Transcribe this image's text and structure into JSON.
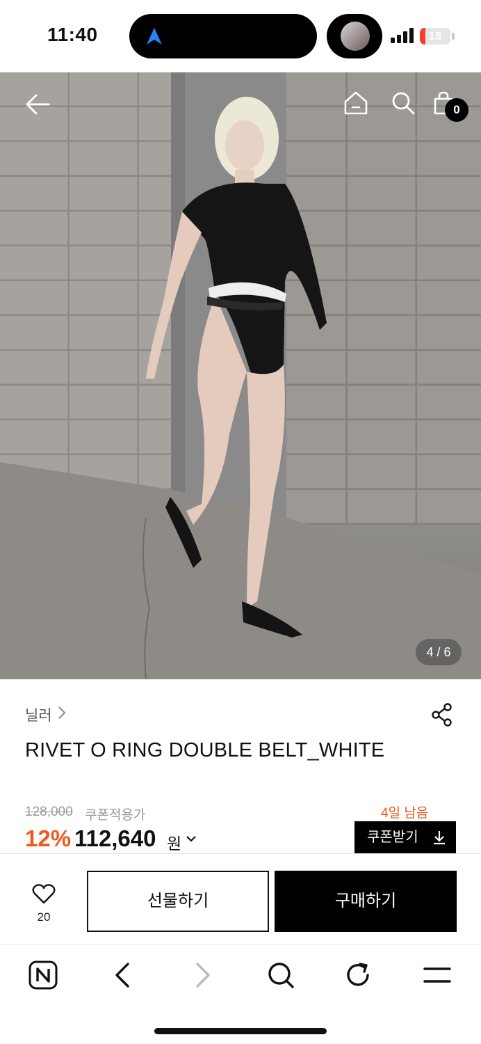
{
  "status_bar": {
    "time": "11:40",
    "battery": "18"
  },
  "header": {
    "cart_count": "0"
  },
  "gallery": {
    "counter": "4 / 6"
  },
  "product": {
    "brand": "닐러",
    "name": "RIVET O RING DOUBLE BELT_WHITE",
    "original_price": "128,000",
    "coupon_label": "쿠폰적용가",
    "discount": "12%",
    "final_price": "112,640",
    "currency": "원",
    "coupon_days_left": "4일 남음",
    "coupon_button": "쿠폰받기"
  },
  "actions": {
    "like_count": "20",
    "gift_label": "선물하기",
    "buy_label": "구매하기"
  },
  "colors": {
    "accent": "#f2571b",
    "primary": "#000000"
  }
}
